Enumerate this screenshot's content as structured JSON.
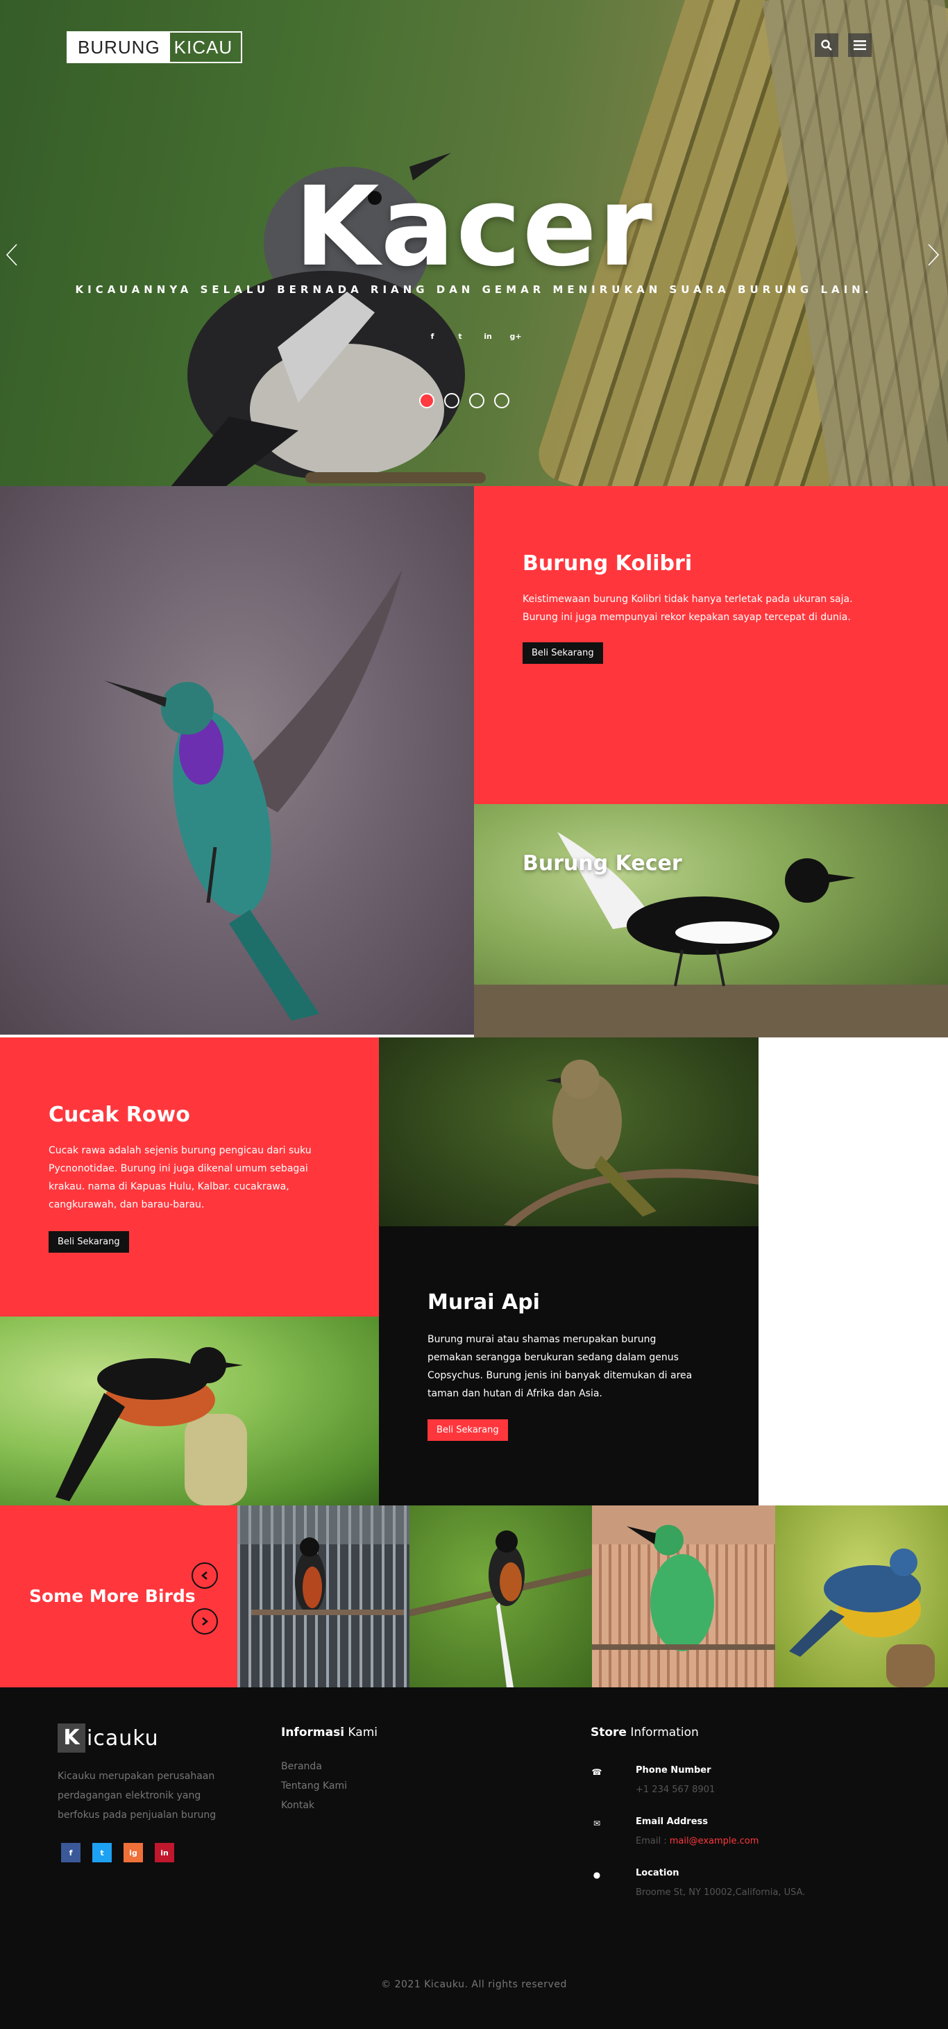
{
  "header": {
    "brand_left": "BURUNG",
    "brand_right": "KICAU",
    "search_icon": "search-icon",
    "menu_icon": "hamburger-menu-icon"
  },
  "hero": {
    "title": "Kacer",
    "subtitle": "KICAUANNYA SELALU BERNADA RIANG DAN GEMAR MENIRUKAN SUARA BURUNG LAIN.",
    "social": [
      "f",
      "t",
      "in",
      "g+"
    ],
    "slide_count": 4,
    "active_slide": 1,
    "accent_color": "#ff373d"
  },
  "kolibri": {
    "title": "Burung Kolibri",
    "text_line1": "Keistimewaan burung Kolibri tidak hanya terletak pada ukuran saja.",
    "text_line2": "Burung ini juga mempunyai rekor kepakan sayap tercepat di dunia.",
    "button": "Beli Sekarang"
  },
  "kecer": {
    "title": "Burung Kecer"
  },
  "cucak": {
    "title": "Cucak Rowo",
    "lines": [
      "Cucak rawa adalah sejenis burung pengicau dari suku",
      "Pycnonotidae. Burung ini juga dikenal umum sebagai",
      "krakau. nama di Kapuas Hulu, Kalbar. cucakrawa,",
      "cangkurawah, dan barau-barau."
    ],
    "button": "Beli Sekarang"
  },
  "murai": {
    "title": "Murai Api",
    "lines": [
      "Burung murai atau shamas merupakan burung",
      "pemakan serangga berukuran sedang dalam genus",
      "Copsychus. Burung jenis ini banyak ditemukan di area",
      "taman dan hutan di Afrika dan Asia."
    ],
    "button": "Beli Sekarang"
  },
  "more": {
    "title": "Some More Birds"
  },
  "footer": {
    "logo_k": "K",
    "logo_rest": "icauku",
    "desc_lines": [
      "Kicauku merupakan perusahaan",
      "perdagangan elektronik yang",
      "berfokus pada penjualan burung"
    ],
    "social": [
      "f",
      "t",
      "ig",
      "in"
    ],
    "info_title_bold": "Informasi",
    "info_title_rest": " Kami",
    "links": [
      "Beranda",
      "Tentang Kami",
      "Kontak"
    ],
    "store_title_bold": "Store",
    "store_title_rest": " Information",
    "phone_label": "Phone Number",
    "phone_value": "+1 234 567 8901",
    "email_label": "Email Address",
    "email_prefix": "Email : ",
    "email_value": "mail@example.com",
    "location_label": "Location",
    "location_value": "Broome St, NY 10002,California, USA.",
    "copyright": "© 2021 Kicauku. All rights reserved"
  }
}
